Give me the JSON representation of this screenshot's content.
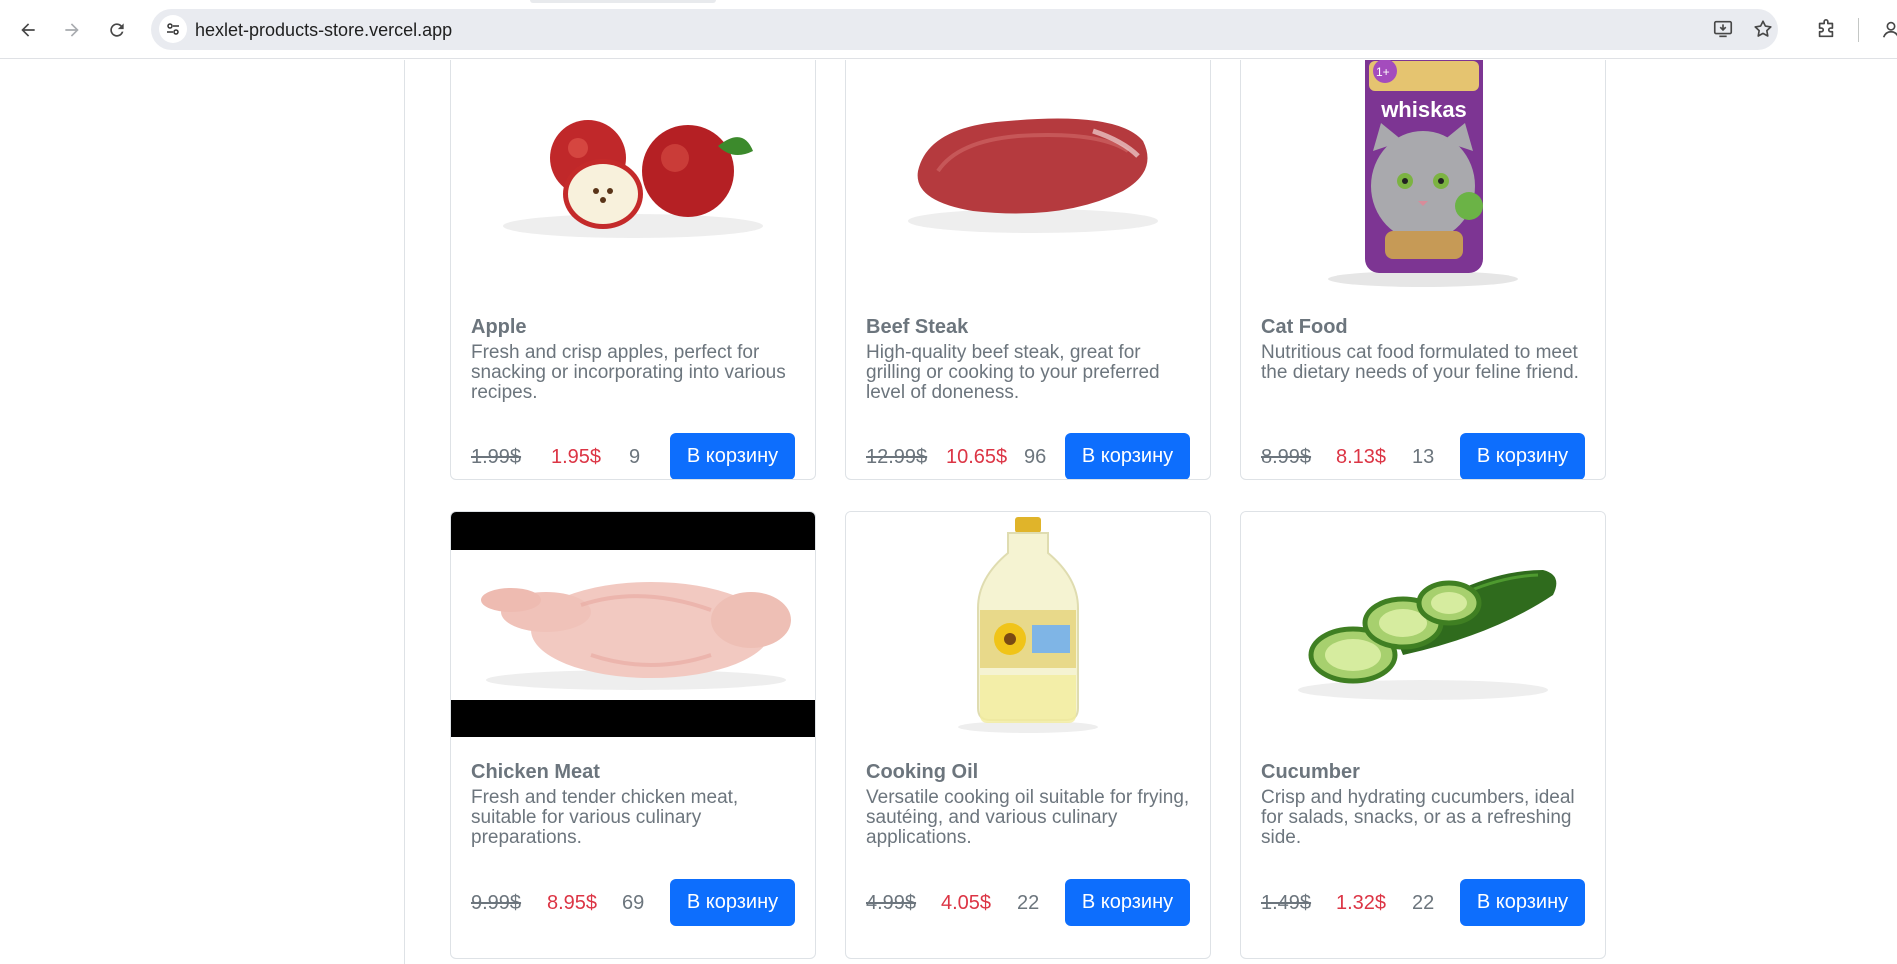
{
  "browser": {
    "url": "hexlet-products-store.vercel.app"
  },
  "products": [
    {
      "name": "Apple",
      "description": "Fresh and crisp apples, perfect for snacking or incorporating into various recipes.",
      "old_price": "1.99$",
      "price": "1.95$",
      "count": "9",
      "button": "В корзину"
    },
    {
      "name": "Beef Steak",
      "description": "High-quality beef steak, great for grilling or cooking to your preferred level of doneness.",
      "old_price": "12.99$",
      "price": "10.65$",
      "count": "96",
      "button": "В корзину"
    },
    {
      "name": "Cat Food",
      "description": "Nutritious cat food formulated to meet the dietary needs of your feline friend.",
      "old_price": "8.99$",
      "price": "8.13$",
      "count": "13",
      "button": "В корзину"
    },
    {
      "name": "Chicken Meat",
      "description": "Fresh and tender chicken meat, suitable for various culinary preparations.",
      "old_price": "9.99$",
      "price": "8.95$",
      "count": "69",
      "button": "В корзину"
    },
    {
      "name": "Cooking Oil",
      "description": "Versatile cooking oil suitable for frying, sautéing, and various culinary applications.",
      "old_price": "4.99$",
      "price": "4.05$",
      "count": "22",
      "button": "В корзину"
    },
    {
      "name": "Cucumber",
      "description": "Crisp and hydrating cucumbers, ideal for salads, snacks, or as a refreshing side.",
      "old_price": "1.49$",
      "price": "1.32$",
      "count": "22",
      "button": "В корзину"
    }
  ],
  "cat_food_brand": "whiskas",
  "colors": {
    "primary": "#0d6efd",
    "sale": "#dc3545",
    "muted": "#6c757d"
  }
}
